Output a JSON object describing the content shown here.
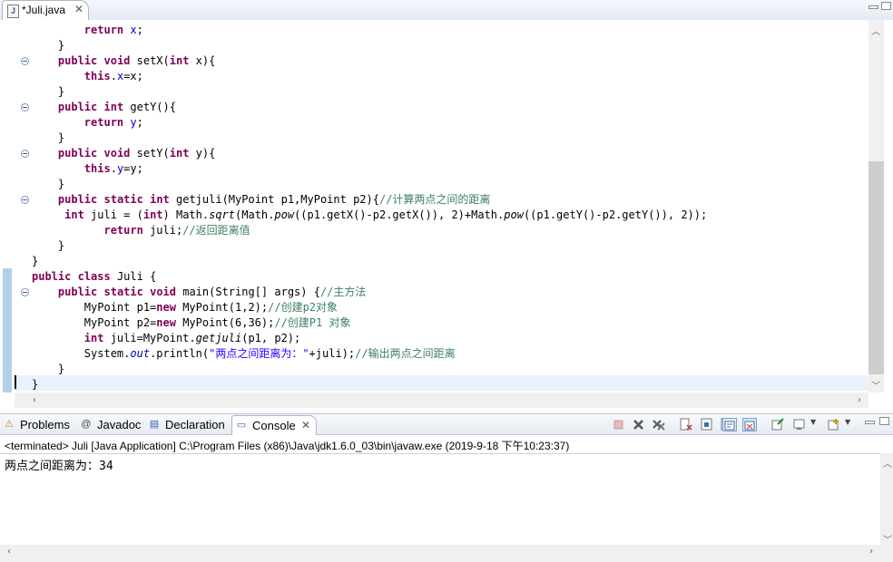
{
  "editor": {
    "tab_title": "*Juli.java",
    "tab_close": "✕",
    "lines": [
      [
        "        ",
        [
          "kw",
          "return"
        ],
        " ",
        [
          "fd",
          "x"
        ],
        ";"
      ],
      [
        "    }"
      ],
      [
        "    ",
        [
          "kw",
          "public"
        ],
        " ",
        [
          "kw",
          "void"
        ],
        " setX(",
        [
          "kw",
          "int"
        ],
        " x){"
      ],
      [
        "        ",
        [
          "kw",
          "this"
        ],
        ".",
        [
          "fd",
          "x"
        ],
        "=x;"
      ],
      [
        "    }"
      ],
      [
        "    ",
        [
          "kw",
          "public"
        ],
        " ",
        [
          "kw",
          "int"
        ],
        " getY(){"
      ],
      [
        "        ",
        [
          "kw",
          "return"
        ],
        " ",
        [
          "fd",
          "y"
        ],
        ";"
      ],
      [
        "    }"
      ],
      [
        "    ",
        [
          "kw",
          "public"
        ],
        " ",
        [
          "kw",
          "void"
        ],
        " setY(",
        [
          "kw",
          "int"
        ],
        " y){"
      ],
      [
        "        ",
        [
          "kw",
          "this"
        ],
        ".",
        [
          "fd",
          "y"
        ],
        "=y;"
      ],
      [
        "    }"
      ],
      [
        "    ",
        [
          "kw",
          "public"
        ],
        " ",
        [
          "kw",
          "static"
        ],
        " ",
        [
          "kw",
          "int"
        ],
        " getjuli(MyPoint p1,MyPoint p2){",
        [
          "cm",
          "//计算两点之间的距离"
        ]
      ],
      [
        "     ",
        [
          "kw",
          "int"
        ],
        " juli = (",
        [
          "kw",
          "int"
        ],
        ") Math.",
        [
          "it",
          "sqrt"
        ],
        "(Math.",
        [
          "it",
          "pow"
        ],
        "((p1.getX()-p2.getX()), 2)+Math.",
        [
          "it",
          "pow"
        ],
        "((p1.getY()-p2.getY()), 2));"
      ],
      [
        "           ",
        [
          "kw",
          "return"
        ],
        " juli;",
        [
          "cm",
          "//返回距离值"
        ]
      ],
      [
        "    }"
      ],
      [
        "}"
      ],
      [
        [
          "kw",
          "public"
        ],
        " ",
        [
          "kw",
          "class"
        ],
        " Juli {"
      ],
      [
        "    ",
        [
          "kw",
          "public"
        ],
        " ",
        [
          "kw",
          "static"
        ],
        " ",
        [
          "kw",
          "void"
        ],
        " main(String[] args) {",
        [
          "cm",
          "//主方法"
        ]
      ],
      [
        "        MyPoint p1=",
        [
          "kw",
          "new"
        ],
        " MyPoint(1,2);",
        [
          "cm",
          "//创建p2对象"
        ]
      ],
      [
        "        MyPoint p2=",
        [
          "kw",
          "new"
        ],
        " MyPoint(6,36);",
        [
          "cm",
          "//创建P1 对象"
        ]
      ],
      [
        "        ",
        [
          "kw",
          "int"
        ],
        " juli=MyPoint.",
        [
          "it",
          "getjuli"
        ],
        "(p1, p2);"
      ],
      [
        "        System.",
        [
          "st",
          "out"
        ],
        ".println(",
        [
          "s",
          "\"两点之间距离为：\""
        ],
        "+juli);",
        [
          "cm",
          "//输出两点之间距离"
        ]
      ],
      [
        "    }"
      ],
      [
        "}"
      ]
    ],
    "fold_rows": [
      2,
      5,
      8,
      11,
      17
    ]
  },
  "views": {
    "tabs": [
      {
        "label": "Problems",
        "icon": "problems-icon",
        "glyph": "⚠"
      },
      {
        "label": "Javadoc",
        "icon": "javadoc-icon",
        "glyph": "@"
      },
      {
        "label": "Declaration",
        "icon": "declaration-icon",
        "glyph": "▤"
      },
      {
        "label": "Console",
        "icon": "console-icon",
        "glyph": "▭"
      }
    ],
    "active_close": "✕"
  },
  "console": {
    "status": "<terminated> Juli [Java Application] C:\\Program Files (x86)\\Java\\jdk1.6.0_03\\bin\\javaw.exe (2019-9-18 下午10:23:37)",
    "output": "两点之间距离为：34"
  },
  "colors": {
    "keyword": "#7f0055",
    "field": "#0000c0",
    "comment": "#3f7f5f",
    "string": "#2a00ff",
    "current_line": "#e8f2fe"
  }
}
